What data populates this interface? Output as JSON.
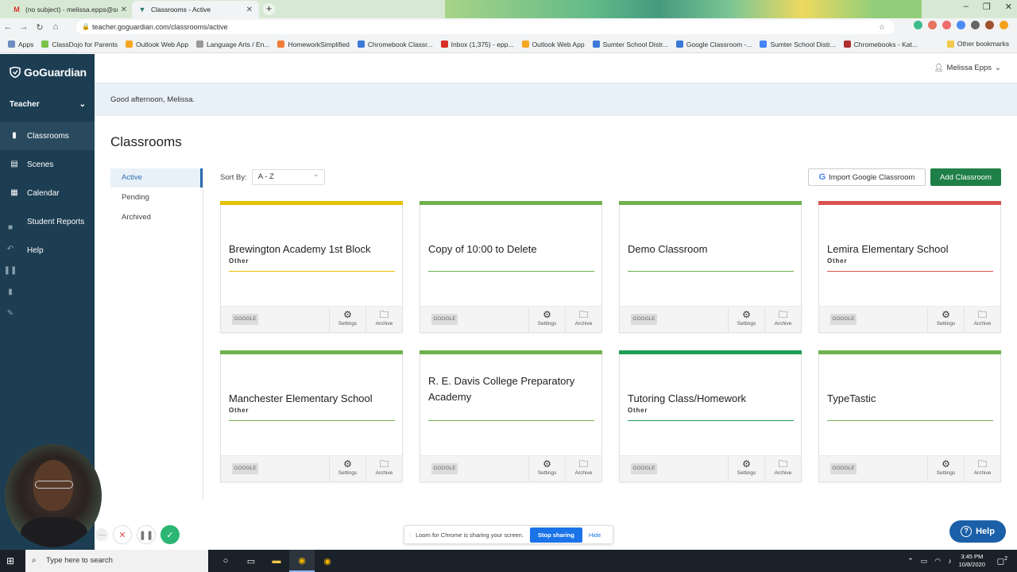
{
  "browser": {
    "tabs": [
      {
        "title": "(no subject) - melissa.epps@sum",
        "icon": "gmail-icon"
      },
      {
        "title": "Classrooms - Active",
        "icon": "goguardian-icon"
      }
    ],
    "url": "teacher.goguardian.com/classrooms/active",
    "bookmarks": [
      "Apps",
      "ClassDojo for Parents",
      "Outlook Web App",
      "Language Arts / En...",
      "HomeworkSimplified",
      "Chromebook Classr...",
      "Inbox (1,375) - epp...",
      "Outlook Web App",
      "Sumter School Distr...",
      "Google Classroom -...",
      "Sumter School Distr...",
      "Chromebooks - Kat..."
    ],
    "other_bookmarks": "Other bookmarks"
  },
  "sidebar": {
    "logo": "GoGuardian",
    "role": "Teacher",
    "items": [
      {
        "label": "Classrooms",
        "icon": "book-icon"
      },
      {
        "label": "Scenes",
        "icon": "scenes-icon"
      },
      {
        "label": "Calendar",
        "icon": "calendar-icon"
      },
      {
        "label": "Student Reports",
        "icon": "reports-icon"
      },
      {
        "label": "Help",
        "icon": "help-icon"
      }
    ]
  },
  "header": {
    "user": "Melissa Epps",
    "greeting": "Good afternoon, Melissa."
  },
  "main": {
    "title": "Classrooms",
    "filters": [
      "Active",
      "Pending",
      "Archived"
    ],
    "sort_label": "Sort By:",
    "sort_value": "A - Z",
    "import_label": "Import Google Classroom",
    "add_label": "Add Classroom",
    "cards": [
      {
        "title": "Brewington Academy 1st Block",
        "subtitle": "Other",
        "color": "#e6c200"
      },
      {
        "title": "Copy of 10:00 to Delete",
        "subtitle": "",
        "color": "#6fb14d"
      },
      {
        "title": "Demo Classroom",
        "subtitle": "",
        "color": "#6fb14d"
      },
      {
        "title": "Lemira Elementary School",
        "subtitle": "Other",
        "color": "#d9534f"
      },
      {
        "title": "Manchester Elementary School",
        "subtitle": "Other",
        "color": "#6fb14d"
      },
      {
        "title": "R. E. Davis College Preparatory Academy",
        "subtitle": "",
        "color": "#6fb14d"
      },
      {
        "title": "Tutoring Class/Homework",
        "subtitle": "Other",
        "color": "#1f9d55"
      },
      {
        "title": "TypeTastic",
        "subtitle": "",
        "color": "#6fb14d"
      }
    ],
    "card_badge": "GOOGLE",
    "settings_label": "Settings",
    "archive_label": "Archive"
  },
  "loom": {
    "message": "Loom for Chrome is sharing your screen.",
    "stop": "Stop sharing",
    "hide": "Hide"
  },
  "help_button": "Help",
  "taskbar": {
    "search_placeholder": "Type here to search",
    "time": "3:45 PM",
    "date": "10/8/2020",
    "notifications": "2"
  }
}
